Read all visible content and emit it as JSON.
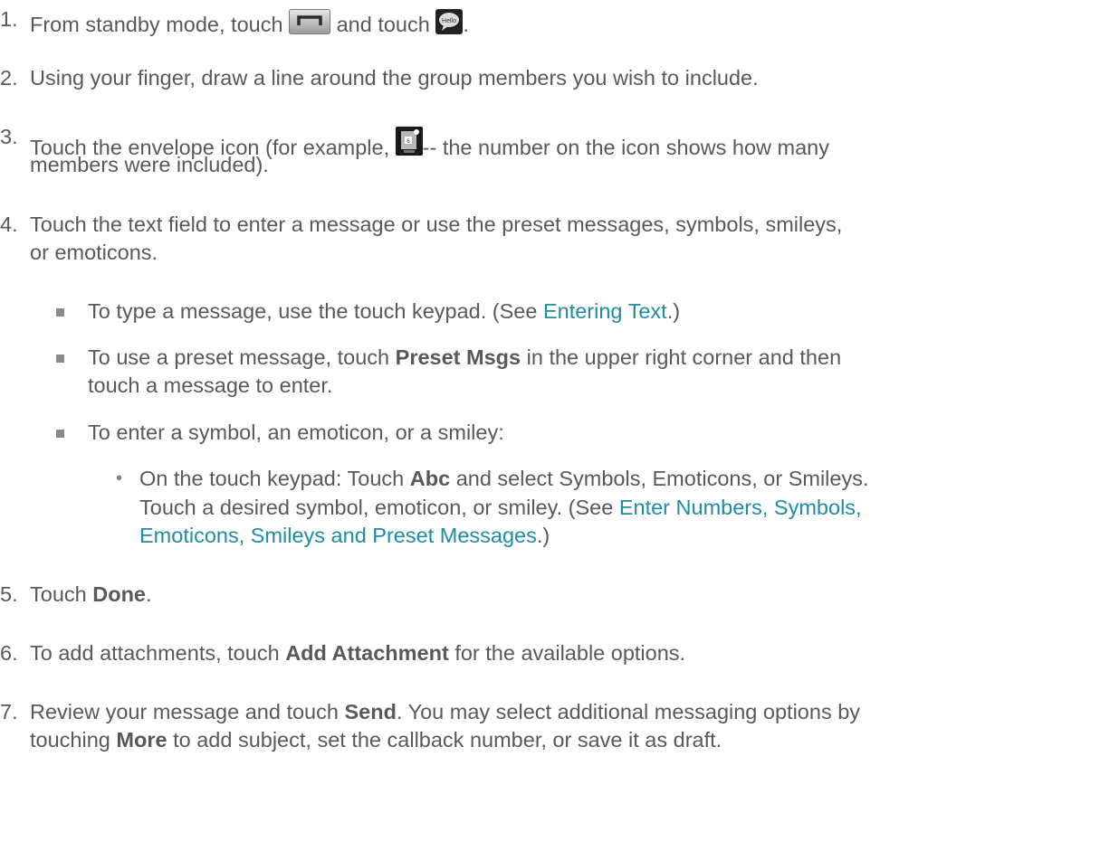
{
  "steps": [
    {
      "num": "1.",
      "t1": "From standby mode, touch",
      "t2": "and touch",
      "t3": "."
    },
    {
      "num": "2.",
      "line1": "Using your finger, draw a line around the group members you wish to include."
    },
    {
      "num": "3.",
      "t1": "Touch the envelope icon (for example,",
      "t2": "-- the number on the icon shows how many",
      "line2": "members were included)."
    },
    {
      "num": "4.",
      "line1": "Touch the text field to enter a message or use the preset messages, symbols, smileys,",
      "line2": "or emoticons."
    },
    {
      "num": "5.",
      "t1": "Touch",
      "b1": "Done",
      "t2": "."
    },
    {
      "num": "6.",
      "t1": "To add attachments, touch",
      "b1": "Add Attachment",
      "t2": "for the available options."
    },
    {
      "num": "7.",
      "t1": "Review your message and touch",
      "b1": "Send",
      "t2": ". You may select additional messaging options by",
      "t3": "touching",
      "b2": "More",
      "t4": "to add subject, set the callback number, or save it as draft."
    }
  ],
  "bullets": [
    {
      "t1": "To type a message, use the touch keypad. (See",
      "link": "Entering Text",
      "t2": ".)"
    },
    {
      "t1": "To use a preset message, touch",
      "b1": "Preset Msgs",
      "t2": "in the upper right corner and then",
      "line2": "touch a message to enter."
    },
    {
      "t1": "To enter a symbol, an emoticon, or a smiley:"
    }
  ],
  "subbullet": {
    "t1": "On the touch keypad: Touch",
    "b1": "Abc",
    "t2": "and select Symbols, Emoticons, or Smileys.",
    "line2a": "Touch a desired symbol, emoticon, or smiley. (See",
    "link": "Enter Numbers, Symbols, Emoticons, Smileys and Preset Messages",
    "link_line1": "Enter Numbers, Symbols,",
    "link_line2": "Emoticons, Smileys and Preset Messages",
    "line3b": ".)"
  },
  "icons": [
    "menu-key-icon",
    "hello-message-app-icon",
    "envelope-group-icon"
  ],
  "colors": {
    "text": "#595959",
    "link": "#1f8ca4"
  }
}
